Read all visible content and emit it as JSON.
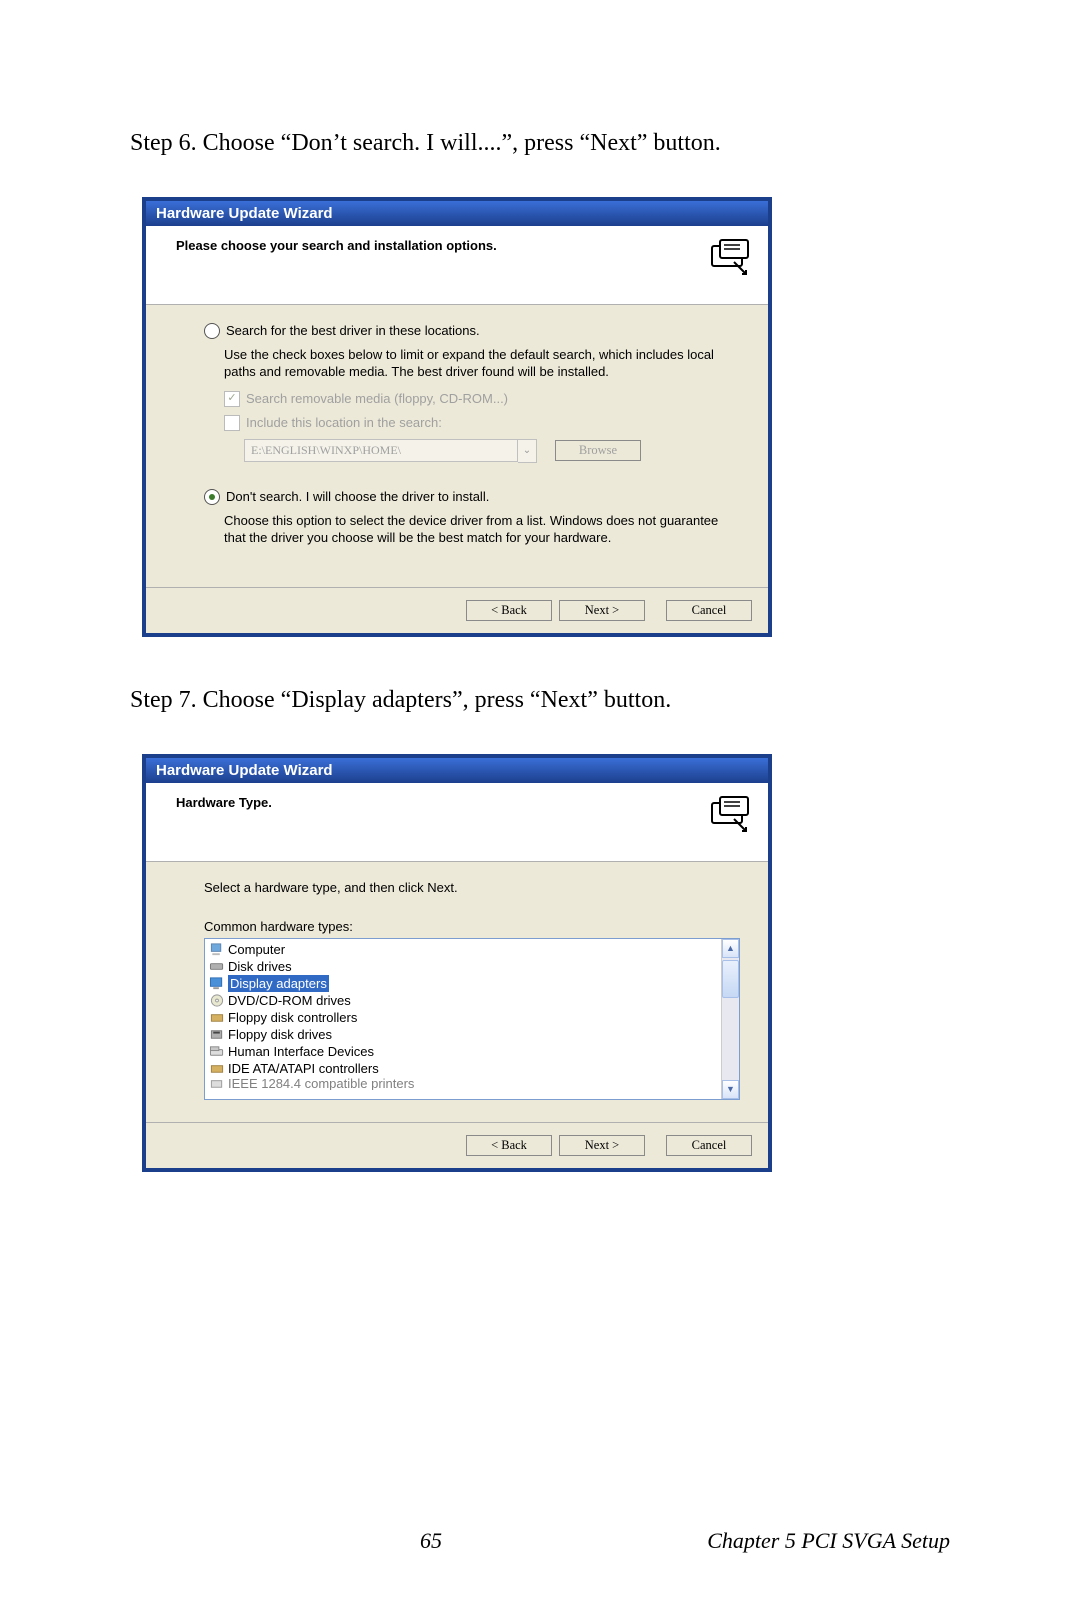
{
  "step6_text": "Step 6.  Choose “Don’t search. I will....”, press “Next” button.",
  "step7_text": "Step 7.  Choose “Display adapters”, press “Next” button.",
  "wizard1": {
    "title": "Hardware Update Wizard",
    "heading": "Please choose your search and installation options.",
    "option1_label": "Search for the best driver in these locations.",
    "option1_help": "Use the check boxes below to limit or expand the default search, which includes local paths and removable media. The best driver found will be installed.",
    "chk1_label": "Search removable media (floppy, CD-ROM...)",
    "chk2_label": "Include this location in the search:",
    "path_value": "E:\\ENGLISH\\WINXP\\HOME\\",
    "browse_btn": "Browse",
    "option2_label": "Don't search. I will choose the driver to install.",
    "option2_help": "Choose this option to select the device driver from a list.  Windows does not guarantee that the driver you choose will be the best match for your hardware.",
    "back_btn": "< Back",
    "next_btn": "Next >",
    "cancel_btn": "Cancel"
  },
  "wizard2": {
    "title": "Hardware Update Wizard",
    "heading": "Hardware Type.",
    "instruct": "Select a hardware type, and then click Next.",
    "list_label": "Common hardware types:",
    "items": {
      "i0": "Computer",
      "i1": "Disk drives",
      "i2": "Display adapters",
      "i3": "DVD/CD-ROM drives",
      "i4": "Floppy disk controllers",
      "i5": "Floppy disk drives",
      "i6": "Human Interface Devices",
      "i7": "IDE ATA/ATAPI controllers",
      "i8": "IEEE 1284.4 compatible printers"
    },
    "back_btn": "< Back",
    "next_btn": "Next >",
    "cancel_btn": "Cancel"
  },
  "footer": {
    "page_number": "65",
    "chapter": "Chapter 5  PCI SVGA Setup"
  }
}
